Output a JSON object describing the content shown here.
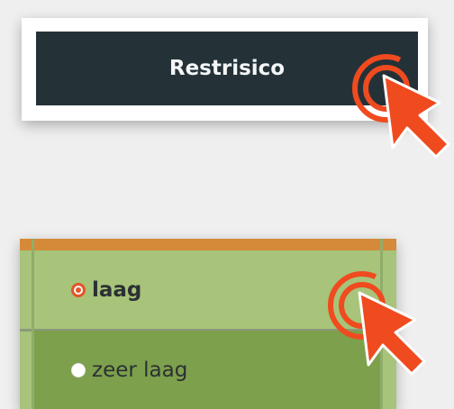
{
  "restrisico_button": {
    "label": "Restrisico"
  },
  "risk_options": [
    {
      "label": "laag",
      "selected": true
    },
    {
      "label": "zeer laag",
      "selected": false
    }
  ],
  "colors": {
    "button_bg": "#243238",
    "orange_strip": "#d58a3a",
    "row_light_green": "#a7c47a",
    "row_dark_green": "#7da04c",
    "click_accent": "#f04a1f"
  }
}
